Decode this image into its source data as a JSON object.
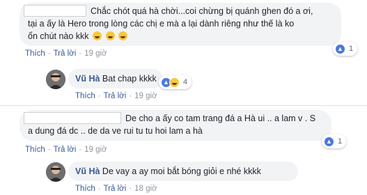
{
  "comments": [
    {
      "text_line1": "Chắc chót quá hà chời...coi chừng bị quánh ghen đó a ơi,",
      "text_line2": "tại a ấy là Hero trong lòng các chị e mà a lại dành riêng như thế là ko",
      "text_line3": "ổn chút nào kkk",
      "like_label": "Thích",
      "reply_label": "Trả lời",
      "time": "19 giờ",
      "reaction_count": "1"
    },
    {
      "author": "Vũ Hà",
      "text": "Bat chap kkkk",
      "like_label": "Thích",
      "reply_label": "Trả lời",
      "time": "19 giờ",
      "reaction_count": "4"
    },
    {
      "text_line1": "De cho a ấy co tam trang đá a Hà ui .. a lam v . S",
      "text_line2": "a dung đá dc .. de da ve rui tu tu hoi lam a hà",
      "like_label": "Thích",
      "reply_label": "Trả lời",
      "time": "19 giờ",
      "reaction_count": "1"
    },
    {
      "author": "Vũ Hà",
      "text": "De vay a ay moi bắt bóng giỏi e nhé kkkk",
      "like_label": "Thích",
      "reply_label": "Trả lời",
      "time": "18 giờ"
    }
  ],
  "icons": {
    "like": "like-icon",
    "haha": "haha-icon",
    "laugh_emoji": "laughing-tears-emoji"
  },
  "colors": {
    "link": "#385898",
    "bubble": "#f2f3f5",
    "like_blue": "#4a78dc"
  }
}
